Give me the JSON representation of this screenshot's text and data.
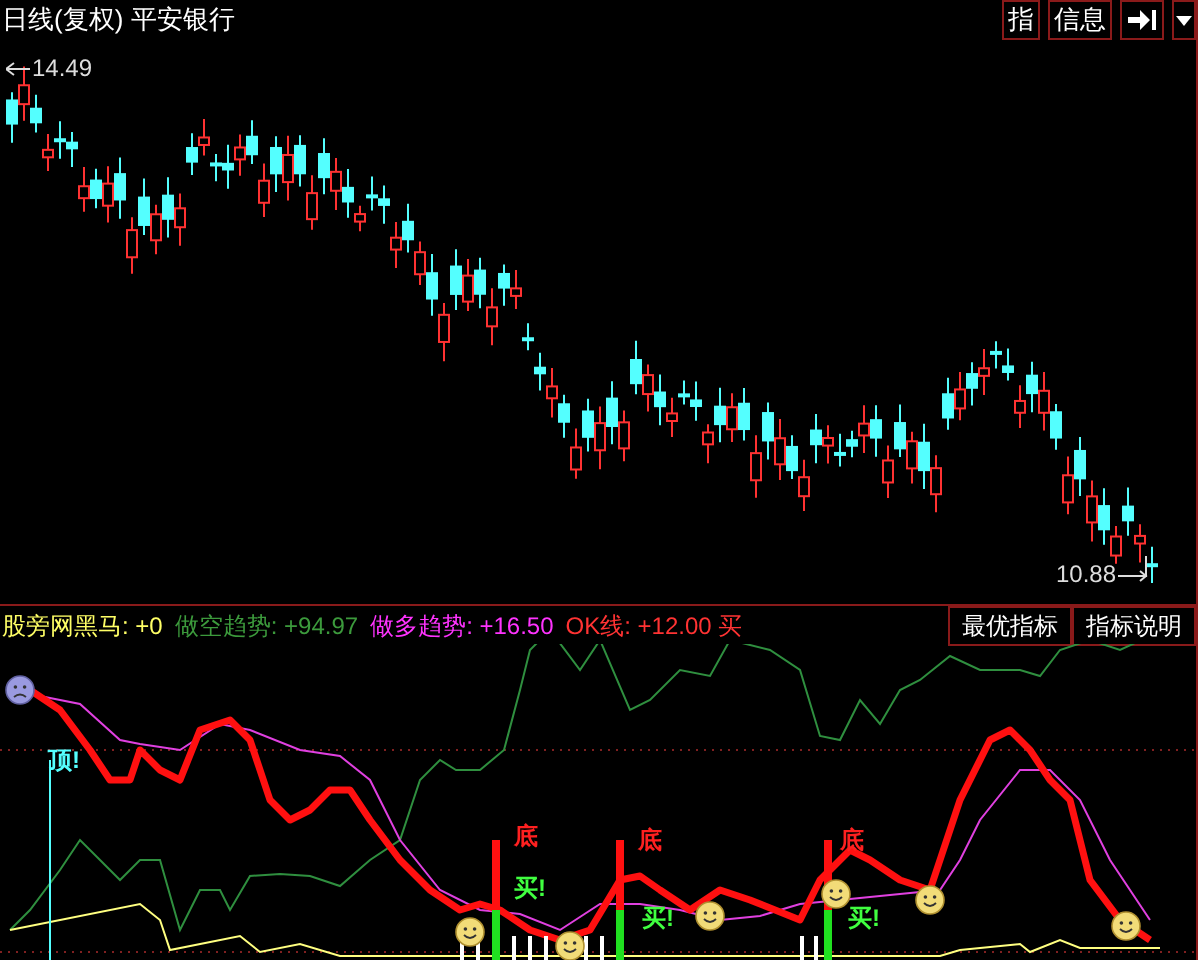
{
  "chart": {
    "period": "日线(复权)",
    "stock": "平安银行",
    "high_label": "14.49",
    "low_label": "10.88"
  },
  "toolbar": [
    {
      "kind": "text",
      "label": "指"
    },
    {
      "kind": "text",
      "label": "信息"
    },
    {
      "kind": "jump"
    },
    {
      "kind": "dropdown"
    }
  ],
  "indicator": {
    "legend": [
      {
        "text": "股旁网黑马: +0",
        "color": "#ffff66"
      },
      {
        "text": "做空趋势: +94.97",
        "color": "#3c9a3c"
      },
      {
        "text": "做多趋势: +16.50",
        "color": "#ff33ff"
      },
      {
        "text": "OK线: +12.00 买",
        "color": "#ff3333"
      }
    ],
    "buttons": [
      "最优指标",
      "指标说明"
    ],
    "signals": [
      {
        "kind": "top",
        "label": "顶!"
      },
      {
        "kind": "bottom",
        "label": "底"
      },
      {
        "kind": "buy",
        "label": "买!"
      },
      {
        "kind": "bottom",
        "label": "底"
      },
      {
        "kind": "buy",
        "label": "买!"
      },
      {
        "kind": "bottom",
        "label": "底"
      },
      {
        "kind": "buy",
        "label": "买!"
      }
    ]
  }
}
